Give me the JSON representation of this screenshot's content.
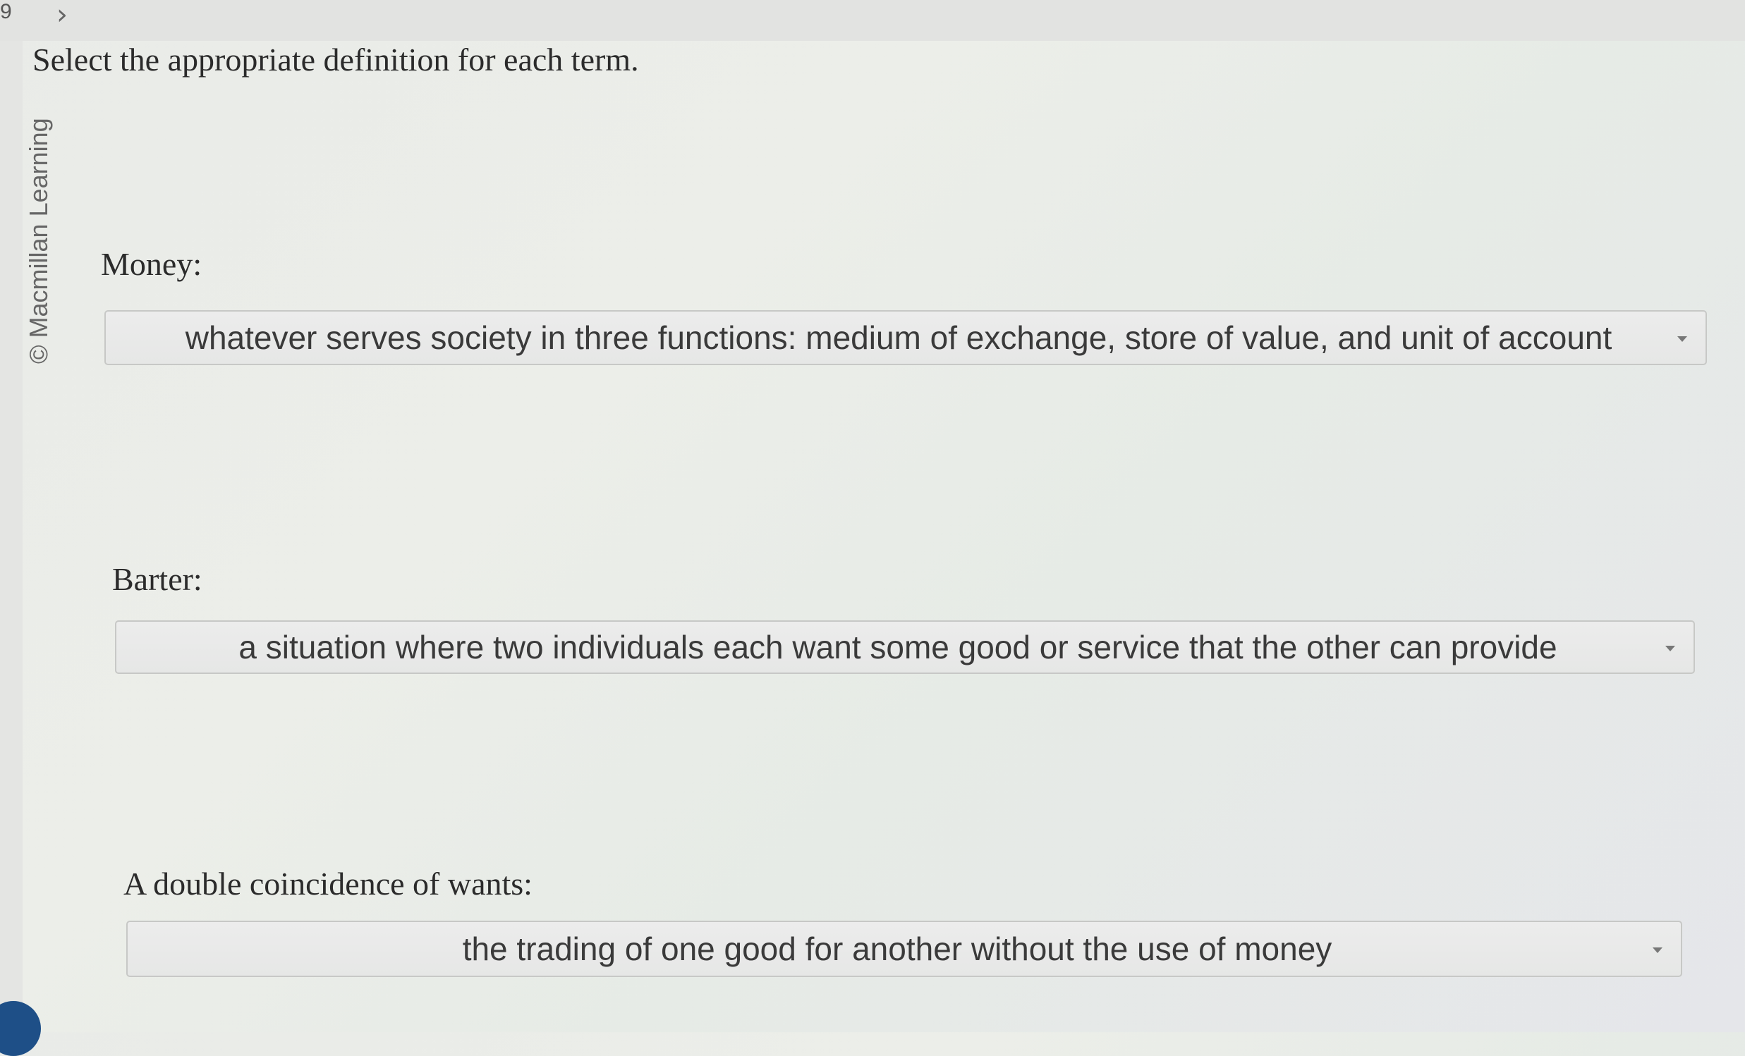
{
  "header": {
    "question_number": "9",
    "next_arrow": "chevron-right-icon"
  },
  "sidebar": {
    "copyright": "© Macmillan Learning"
  },
  "prompt": "Select the appropriate definition for each term.",
  "items": [
    {
      "term": "Money:",
      "selected": "whatever serves society in three functions: medium of exchange, store of value, and unit of account"
    },
    {
      "term": "Barter:",
      "selected": "a situation where two individuals each want some good or service that the other can provide"
    },
    {
      "term": "A double coincidence of wants:",
      "selected": "the trading of one good for another without the use of money"
    }
  ],
  "colors": {
    "accent": "#1e4f87"
  }
}
